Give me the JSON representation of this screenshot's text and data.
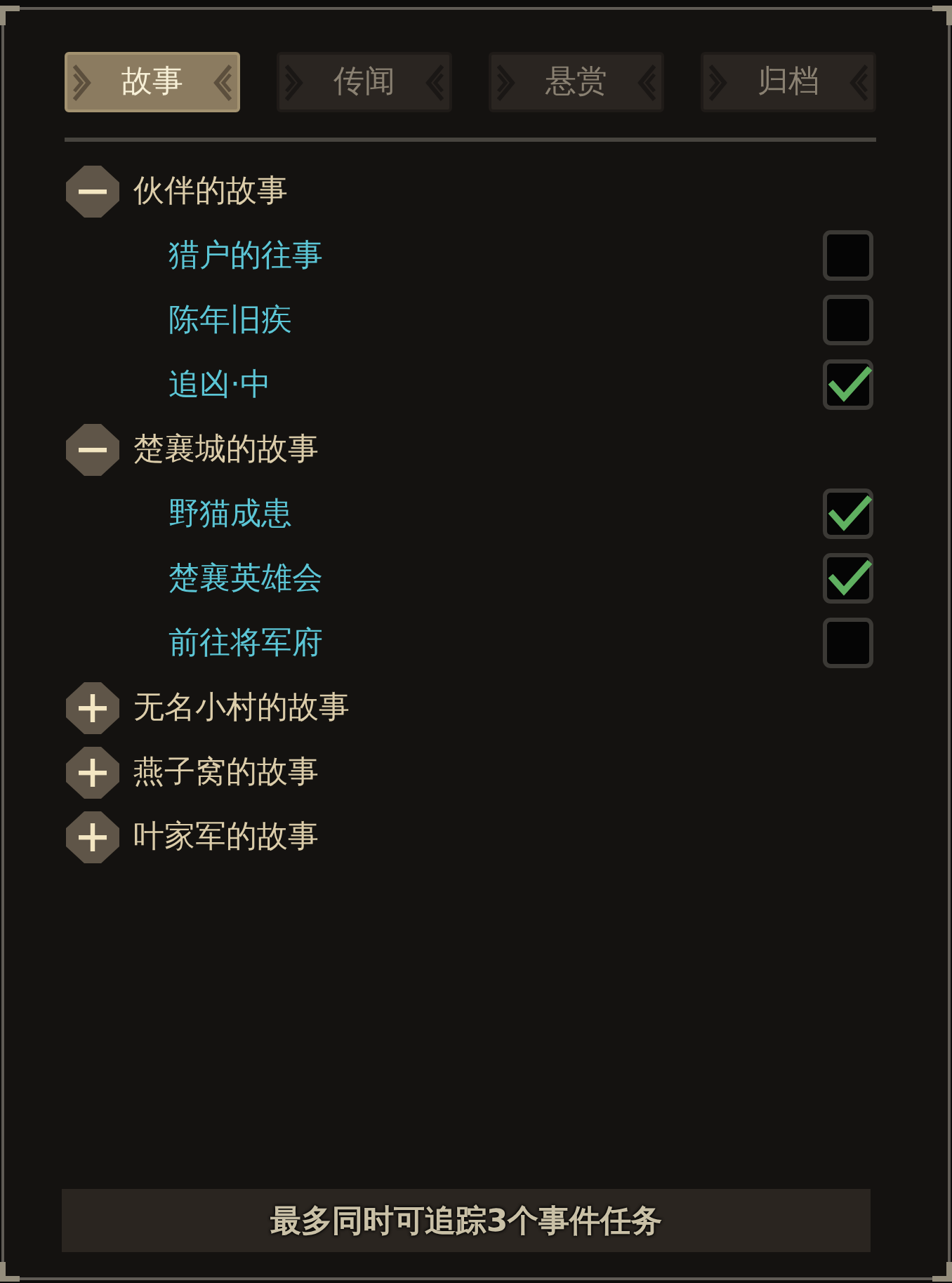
{
  "tabs": [
    {
      "label": "故事",
      "selected": true
    },
    {
      "label": "传闻",
      "selected": false
    },
    {
      "label": "悬赏",
      "selected": false
    },
    {
      "label": "归档",
      "selected": false
    }
  ],
  "groups": [
    {
      "title": "伙伴的故事",
      "expanded": true,
      "children": [
        {
          "title": "猎户的往事",
          "checked": false
        },
        {
          "title": "陈年旧疾",
          "checked": false
        },
        {
          "title": "追凶·中",
          "checked": true
        }
      ]
    },
    {
      "title": "楚襄城的故事",
      "expanded": true,
      "children": [
        {
          "title": "野猫成患",
          "checked": true
        },
        {
          "title": "楚襄英雄会",
          "checked": true
        },
        {
          "title": "前往将军府",
          "checked": false
        }
      ]
    },
    {
      "title": "无名小村的故事",
      "expanded": false
    },
    {
      "title": "燕子窝的故事",
      "expanded": false
    },
    {
      "title": "叶家军的故事",
      "expanded": false
    }
  ],
  "footer": "最多同时可追踪3个事件任务"
}
